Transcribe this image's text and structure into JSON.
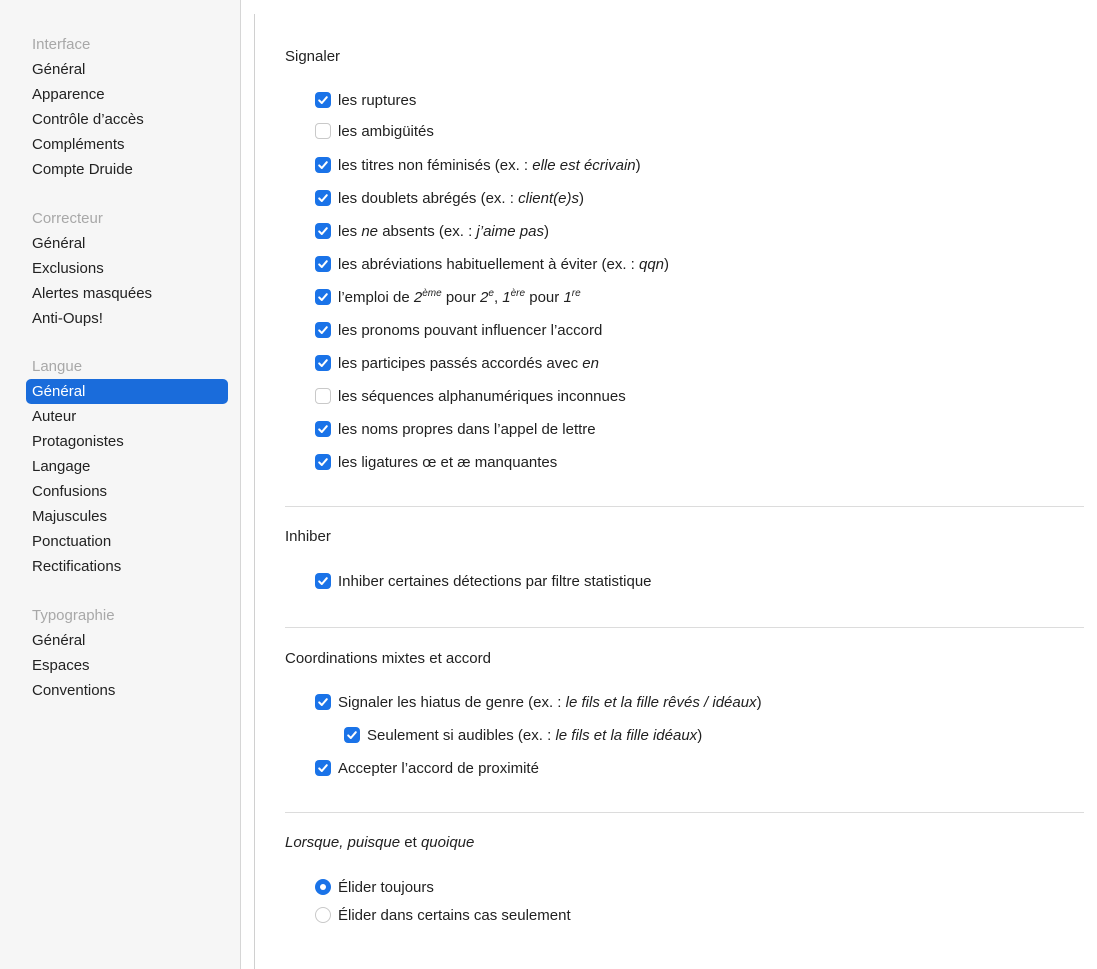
{
  "sidebar": {
    "groups": [
      {
        "title": "Interface",
        "items": [
          "Général",
          "Apparence",
          "Contrôle d’accès",
          "Compléments",
          "Compte Druide"
        ]
      },
      {
        "title": "Correcteur",
        "items": [
          "Général",
          "Exclusions",
          "Alertes masquées",
          "Anti-Oups!"
        ]
      },
      {
        "title": "Langue",
        "items": [
          "Général",
          "Auteur",
          "Protagonistes",
          "Langage",
          "Confusions",
          "Majuscules",
          "Ponctuation",
          "Rectifications"
        ],
        "selected": "Général"
      },
      {
        "title": "Typographie",
        "items": [
          "Général",
          "Espaces",
          "Conventions"
        ]
      }
    ]
  },
  "signaler": {
    "title": "Signaler",
    "items": [
      {
        "checked": true,
        "a": "les ruptures"
      },
      {
        "checked": false,
        "a": "les ambigüités"
      },
      {
        "checked": true,
        "a": "les titres non féminisés (ex. : ",
        "em": "elle est écrivain",
        "b": ")"
      },
      {
        "checked": true,
        "a": "les doublets abrégés (ex. : ",
        "em": "client(e)s",
        "b": ")"
      },
      {
        "checked": true,
        "a": "les ",
        "em": "ne",
        "b": " absents (ex. : ",
        "em2": "j’aime pas",
        "c": ")"
      },
      {
        "checked": true,
        "a": "les abréviations habituellement à éviter (ex. : ",
        "em": "qqn",
        "b": ")"
      },
      {
        "checked": true,
        "a": "l’emploi de ",
        "em": "2",
        "sup": "ème",
        "b": " pour ",
        "em2": "2",
        "sup2": "e",
        "c": ", ",
        "em3": "1",
        "sup3": "ère",
        "d": " pour ",
        "em4": "1",
        "sup4": "re"
      },
      {
        "checked": true,
        "a": "les pronoms pouvant influencer l’accord"
      },
      {
        "checked": true,
        "a": "les participes passés accordés avec ",
        "em": "en"
      },
      {
        "checked": false,
        "a": "les séquences alphanumériques inconnues"
      },
      {
        "checked": true,
        "a": "les noms propres dans l’appel de lettre"
      },
      {
        "checked": true,
        "a": "les ligatures œ et æ manquantes"
      }
    ]
  },
  "inhiber": {
    "title": "Inhiber",
    "items": [
      {
        "checked": true,
        "a": "Inhiber certaines détections par filtre statistique"
      }
    ]
  },
  "coordinations": {
    "title": "Coordinations mixtes et accord",
    "items": [
      {
        "checked": true,
        "a": "Signaler les hiatus de genre (ex. : ",
        "em": "le fils et la fille rêvés / idéaux",
        "b": ")"
      },
      {
        "checked": true,
        "a": "Seulement si audibles (ex. : ",
        "em": "le fils et la fille idéaux",
        "b": ")",
        "indent": true
      },
      {
        "checked": true,
        "a": "Accepter l’accord de proximité"
      }
    ]
  },
  "elision": {
    "title_em": "Lorsque, puisque",
    "title_rest": " et ",
    "title_em2": "quoique",
    "options": [
      {
        "selected": true,
        "label": "Élider toujours"
      },
      {
        "selected": false,
        "label": "Élider dans certains cas seulement"
      }
    ]
  },
  "colors": {
    "accent": "#1a73e8",
    "selection": "#1a6cdb"
  }
}
